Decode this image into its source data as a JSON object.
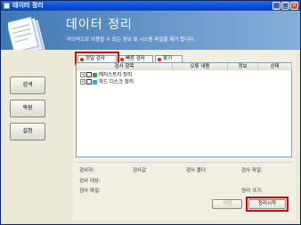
{
  "window": {
    "title": "데이터 정리",
    "controls": {
      "minimize": "_",
      "maximize": "□",
      "close": "✕"
    }
  },
  "header": {
    "title": "데이터 정리",
    "subtitle": "악의적으로 이용될 수 있는 정보 및 시스템 파일을 제거 합니다."
  },
  "sidebar": {
    "items": [
      {
        "label": "검색"
      },
      {
        "label": "복원"
      },
      {
        "label": "설정"
      }
    ]
  },
  "tabs": [
    {
      "label": "정밀 검사",
      "active": true
    },
    {
      "label": "빠른 검사",
      "active": false
    },
    {
      "label": "찾기",
      "active": false
    }
  ],
  "table": {
    "columns": [
      "검사 항목",
      "오류 내용",
      "정보",
      "상태"
    ],
    "rows": [
      {
        "label": "레지스트리 정리",
        "icon": "registry-icon"
      },
      {
        "label": "하드 디스크 정리",
        "icon": "hard-disk-icon"
      }
    ]
  },
  "info": {
    "inspector": "검사자:",
    "inspected_value": "검사값",
    "inspect_folder": "검사 폴더",
    "inspect_files": "검사 파일:",
    "inspect_target": "검사 대상:",
    "inspect_file": "검사 파일:",
    "cleanup_size": "정리 크기:"
  },
  "buttons": {
    "delete": "삭제",
    "start": "정리시작"
  },
  "colors": {
    "titlebar": "#0A4FD8",
    "header_gradient_start": "#3D78B3",
    "highlight": "#DD0000"
  }
}
